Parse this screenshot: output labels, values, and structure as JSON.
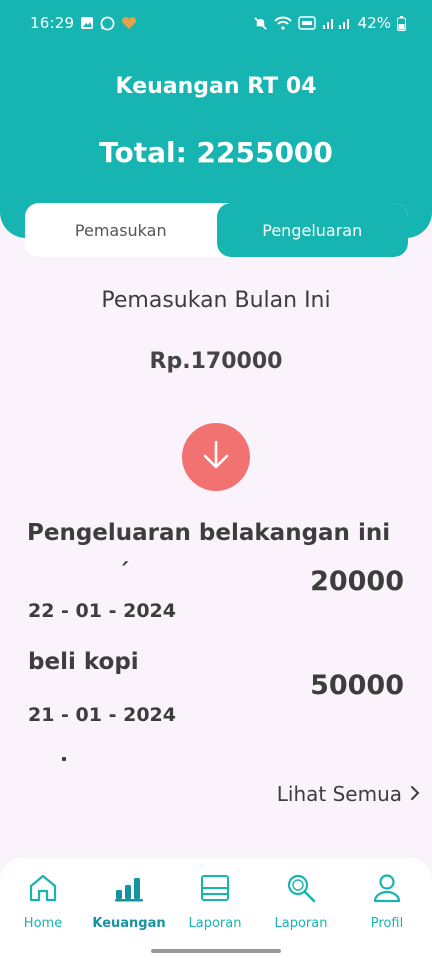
{
  "status_bar": {
    "time": "16:29",
    "battery": "42%",
    "icons": [
      "image-icon",
      "whatsapp-icon",
      "heart-icon",
      "mute-icon",
      "wifi-icon",
      "volte-icon",
      "signal-icon",
      "battery-icon"
    ]
  },
  "header": {
    "title": "Keuangan RT 04",
    "total": "Total: 2255000"
  },
  "tabs": [
    {
      "label": "Pemasukan",
      "active": false
    },
    {
      "label": "Pengeluaran",
      "active": true
    }
  ],
  "summary": {
    "title": "Pemasukan Bulan Ini",
    "amount": "Rp.170000",
    "action_icon": "arrow-down-icon"
  },
  "recent": {
    "title": "Pengeluaran belakangan ini",
    "items": [
      {
        "name": "´",
        "date": "22 - 01 - 2024",
        "amount": "20000"
      },
      {
        "name": "beli kopi",
        "date": "21 - 01 - 2024",
        "amount": "50000"
      }
    ],
    "see_all": "Lihat Semua"
  },
  "nav": {
    "items": [
      {
        "label": "Home",
        "icon": "home-icon",
        "active": false
      },
      {
        "label": "Keuangan",
        "icon": "chart-icon",
        "active": true
      },
      {
        "label": "Laporan",
        "icon": "report-icon",
        "active": false
      },
      {
        "label": "Laporan",
        "icon": "search-icon",
        "active": false
      },
      {
        "label": "Profil",
        "icon": "user-icon",
        "active": false
      }
    ]
  },
  "colors": {
    "primary": "#16b5b1",
    "accent": "#f27272",
    "background": "#fbf3fb"
  }
}
